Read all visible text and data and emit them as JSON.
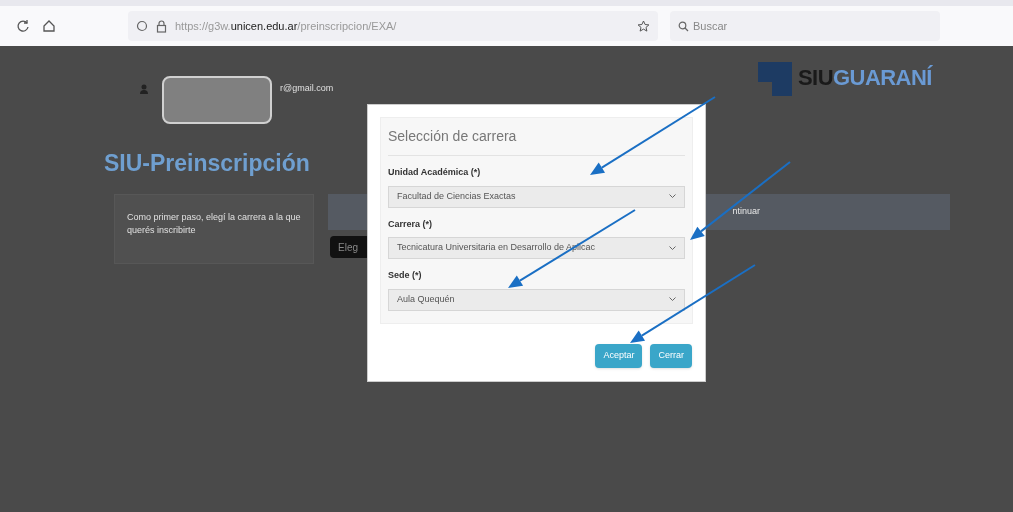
{
  "browser": {
    "url_prefix": "https://g3w.",
    "url_domain": "unicen.edu.ar",
    "url_path": "/preinscripcion/EXA/",
    "search_placeholder": "Buscar"
  },
  "header": {
    "email": "r@gmail.com",
    "logo_dark": "SIU",
    "logo_blue": "GUARANÍ"
  },
  "page": {
    "title": "SIU-Preinscripción",
    "step_text": "Como primer paso, elegí la carrera a la que querés inscribirte",
    "choose_button": "Eleg",
    "right_text": "ntinuar"
  },
  "modal": {
    "title": "Selección de carrera",
    "fields": [
      {
        "label": "Unidad Académica (*)",
        "value": "Facultad de Ciencias Exactas"
      },
      {
        "label": "Carrera (*)",
        "value": "Tecnicatura Universitaria en Desarrollo de Aplicac"
      },
      {
        "label": "Sede (*)",
        "value": "Aula Quequén"
      }
    ],
    "buttons": [
      "Aceptar",
      "Cerrar"
    ]
  }
}
